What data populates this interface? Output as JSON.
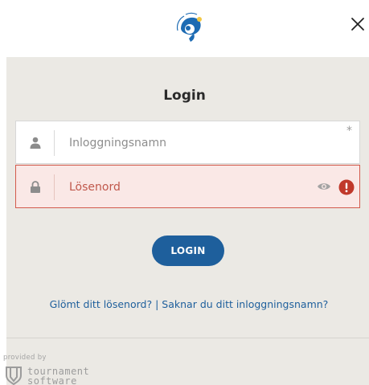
{
  "header": {
    "logo_name": "badminton-sweden-logo",
    "close_icon": "close-icon"
  },
  "form": {
    "title": "Login",
    "username": {
      "placeholder": "Inloggningsnamn",
      "value": "",
      "required_mark": "*",
      "icon": "user-icon"
    },
    "password": {
      "placeholder": "Lösenord",
      "value": "",
      "icon": "lock-icon",
      "show_icon": "eye-icon",
      "error_icon": "error-icon"
    },
    "login_label": "LOGIN",
    "forgot_password_link": "Glömt ditt lösenord?",
    "separator": "|",
    "missing_username_link": "Saknar du ditt inloggningsnamn?"
  },
  "footer": {
    "provided_by": "provided by",
    "brand_line1": "tournament",
    "brand_line2": "software"
  },
  "colors": {
    "accent": "#1e5f9c",
    "error": "#c0392b",
    "error_bg": "#fae8e6",
    "panel_bg": "#ebe9e4"
  }
}
